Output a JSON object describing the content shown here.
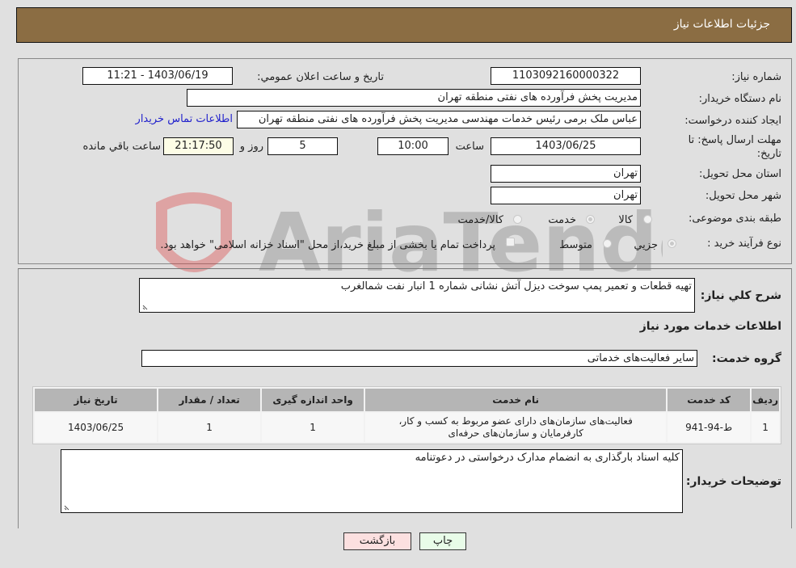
{
  "header": {
    "title": "جزئیات اطلاعات نیاز"
  },
  "fields": {
    "need_number": {
      "label": "شماره نیاز:",
      "value": "1103092160000322"
    },
    "announce_datetime": {
      "label": "تاریخ و ساعت اعلان عمومي:",
      "value": "1403/06/19 - 11:21"
    },
    "buyer_org": {
      "label": "نام دستگاه خریدار:",
      "value": "مدیریت پخش فرآورده های نفتی منطقه تهران"
    },
    "requester": {
      "label": "ایجاد کننده درخواست:",
      "value": "عباس ملک برمی رئیس خدمات مهندسی مدیریت پخش فرآورده های نفتی منطقه تهران"
    },
    "contact_link": "اطلاعات تماس خریدار",
    "deadline": {
      "label_line1": "مهلت ارسال پاسخ: تا",
      "label_line2": "تاریخ:",
      "date": "1403/06/25",
      "time_label": "ساعت",
      "time": "10:00",
      "days": "5",
      "days_label": "روز و",
      "remaining": "21:17:50",
      "remaining_label": "ساعت باقي مانده"
    },
    "province": {
      "label": "استان محل تحویل:",
      "value": "تهران"
    },
    "city": {
      "label": "شهر محل تحویل:",
      "value": "تهران"
    },
    "category": {
      "label": "طبقه بندی موضوعی:",
      "options": [
        "کالا",
        "خدمت",
        "کالا/خدمت"
      ],
      "selected": "خدمت"
    },
    "purchase_type": {
      "label": "نوع فرآیند خرید :",
      "options": [
        "جزيي",
        "متوسط"
      ],
      "selected": "جزيي",
      "treasury_note": "پرداخت تمام یا بخشی از مبلغ خرید،از محل \"اسناد خزانه اسلامی\" خواهد بود."
    }
  },
  "description": {
    "label": "شرح كلي نیاز:",
    "value": "تهیه قطعات و تعمیر پمپ سوخت دیزل آتش نشانی شماره 1 انبار نفت شمالغرب"
  },
  "services_section_title": "اطلاعات خدمات مورد نیاز",
  "service_group": {
    "label": "گروه خدمت:",
    "value": "سایر فعالیت‌های خدماتی"
  },
  "table": {
    "headers": [
      "ردیف",
      "کد خدمت",
      "نام خدمت",
      "واحد اندازه گیری",
      "تعداد / مقدار",
      "تاریخ نیاز"
    ],
    "rows": [
      [
        "1",
        "ط-94-941",
        "فعالیت‌های سازمان‌های دارای عضو مربوط به کسب و کار، کارفرمایان و سازمان‌های حرفه‌ای",
        "1",
        "1",
        "1403/06/25"
      ]
    ]
  },
  "buyer_notes": {
    "label": "توضیحات خریدار:",
    "value": "کلیه اسناد بارگذاری به انضمام مدارک درخواستی در دعوتنامه"
  },
  "buttons": {
    "print": "چاپ",
    "back": "بازگشت"
  },
  "colors": {
    "header_bg": "#8b6d43",
    "print_bg": "#e8fce8",
    "back_bg": "#fce0e0",
    "link": "#2222cc"
  }
}
